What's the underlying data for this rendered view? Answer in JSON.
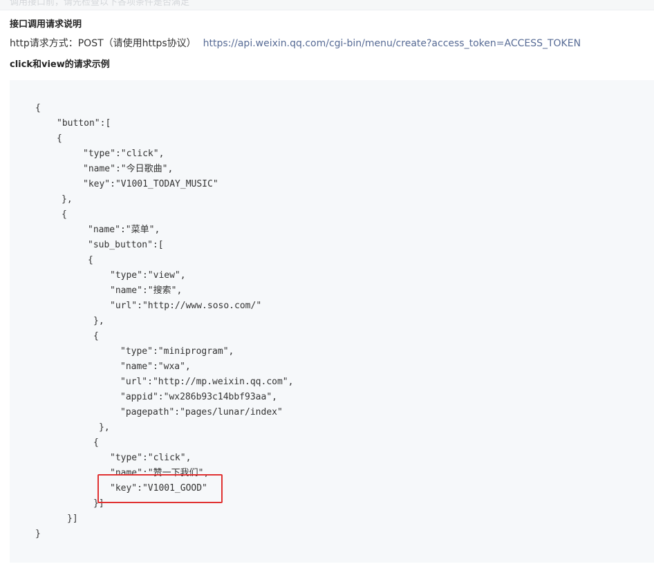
{
  "top_bar": {
    "faded_text": "调用接口前，请先检查以下各项条件是否满足"
  },
  "section": {
    "interface_heading": "接口调用请求说明",
    "request_method_label": "http请求方式：POST（请使用https协议）",
    "request_url": "https://api.weixin.qq.com/cgi-bin/menu/create?access_token=ACCESS_TOKEN",
    "example_heading": "click和view的请求示例"
  },
  "code_lines": [
    "{",
    "\"button\":[",
    "{",
    "\"type\":\"click\",",
    "\"name\":\"今日歌曲\",",
    "\"key\":\"V1001_TODAY_MUSIC\"",
    "},",
    "{",
    "\"name\":\"菜单\",",
    "\"sub_button\":[",
    "{",
    "\"type\":\"view\",",
    "\"name\":\"搜索\",",
    "\"url\":\"http://www.soso.com/\"",
    "},",
    "{",
    "\"type\":\"miniprogram\",",
    "\"name\":\"wxa\",",
    "\"url\":\"http://mp.weixin.qq.com\",",
    "\"appid\":\"wx286b93c14bbf93aa\",",
    "\"pagepath\":\"pages/lunar/index\"",
    "},",
    "{",
    "\"type\":\"click\",",
    "\"name\":\"赞一下我们\",",
    "\"key\":\"V1001_GOOD\"",
    "}]",
    "}]",
    "}"
  ],
  "highlight": {
    "color": "#e03131"
  },
  "colors": {
    "link": "#576b95",
    "code_background": "#f6f8fa"
  }
}
